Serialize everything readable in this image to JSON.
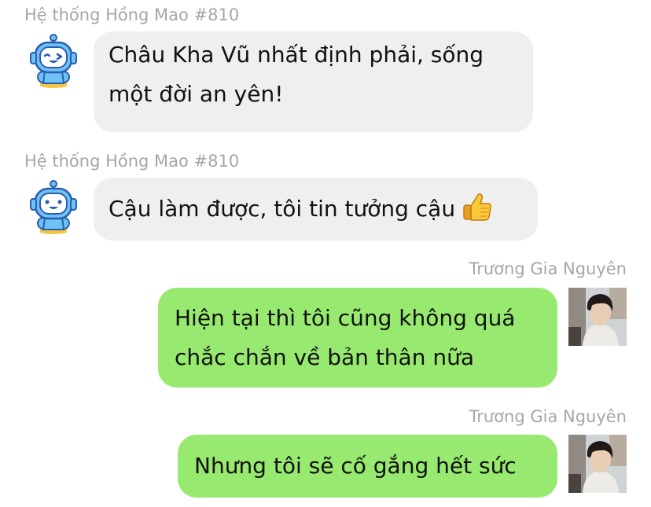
{
  "messages": [
    {
      "sender": "Hệ thống Hồng Mao #810",
      "lines": [
        "Châu Kha Vũ nhất định phải, sống",
        "một đời an yên!"
      ],
      "avatar": "robot-mascot-icon"
    },
    {
      "sender": "Hệ thống Hồng Mao #810",
      "lines": [
        "Cậu làm được, tôi tin tưởng cậu"
      ],
      "emoji": "thumbs-up-icon",
      "avatar": "robot-mascot-icon"
    },
    {
      "sender": "Trương Gia Nguyên",
      "lines": [
        "Hiện tại thì tôi cũng không quá",
        "chắc chắn về bản thân nữa"
      ],
      "avatar": "user-photo-avatar"
    },
    {
      "sender": "Trương Gia Nguyên",
      "lines": [
        "Nhưng tôi sẽ cố gắng hết sức"
      ],
      "avatar": "user-photo-avatar"
    }
  ],
  "colors": {
    "incoming_bubble": "#efefef",
    "outgoing_bubble": "#98e96f",
    "sender_text": "#a6a6a6",
    "message_text": "#111111"
  }
}
